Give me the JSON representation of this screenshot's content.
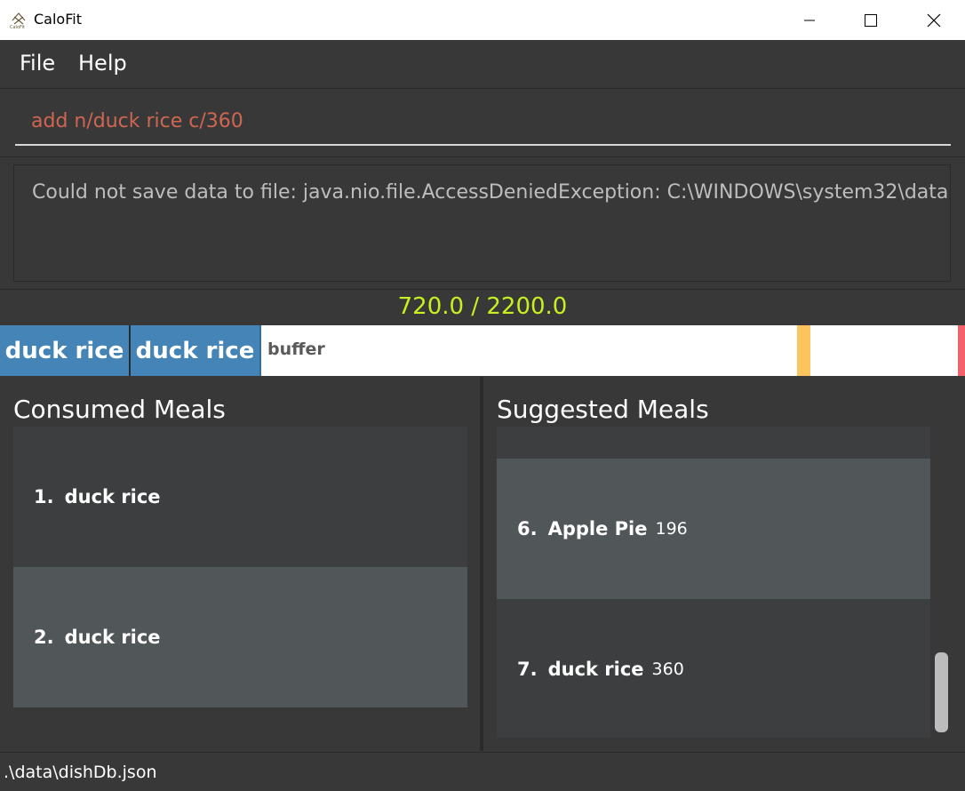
{
  "window": {
    "title": "CaloFit",
    "icon": "calofit-logo-icon"
  },
  "menu": {
    "items": [
      {
        "label": "File"
      },
      {
        "label": "Help"
      }
    ]
  },
  "command": {
    "value": "add n/duck rice c/360",
    "text_color": "#d06651"
  },
  "result": {
    "message": "Could not save data to file: java.nio.file.AccessDeniedException: C:\\WINDOWS\\system32\\data"
  },
  "calories": {
    "display": "720.0 / 2200.0",
    "consumed": 720.0,
    "goal": 2200.0,
    "color": "#c6f01f",
    "bar_segments": [
      {
        "label": "duck rice"
      },
      {
        "label": "duck rice"
      }
    ],
    "buffer_label": "buffer",
    "segment_color": "#4584b6",
    "buffer_color": "#fdc35c",
    "limit_color": "#f2626b"
  },
  "consumed_meals": {
    "title": "Consumed Meals",
    "items": [
      {
        "index": "1.",
        "name": "duck rice"
      },
      {
        "index": "2.",
        "name": "duck rice"
      }
    ]
  },
  "suggested_meals": {
    "title": "Suggested Meals",
    "items": [
      {
        "index": "6.",
        "name": "Apple Pie",
        "calories": "196"
      },
      {
        "index": "7.",
        "name": "duck rice",
        "calories": "360"
      }
    ]
  },
  "status": {
    "path": ".\\data\\dishDb.json"
  }
}
